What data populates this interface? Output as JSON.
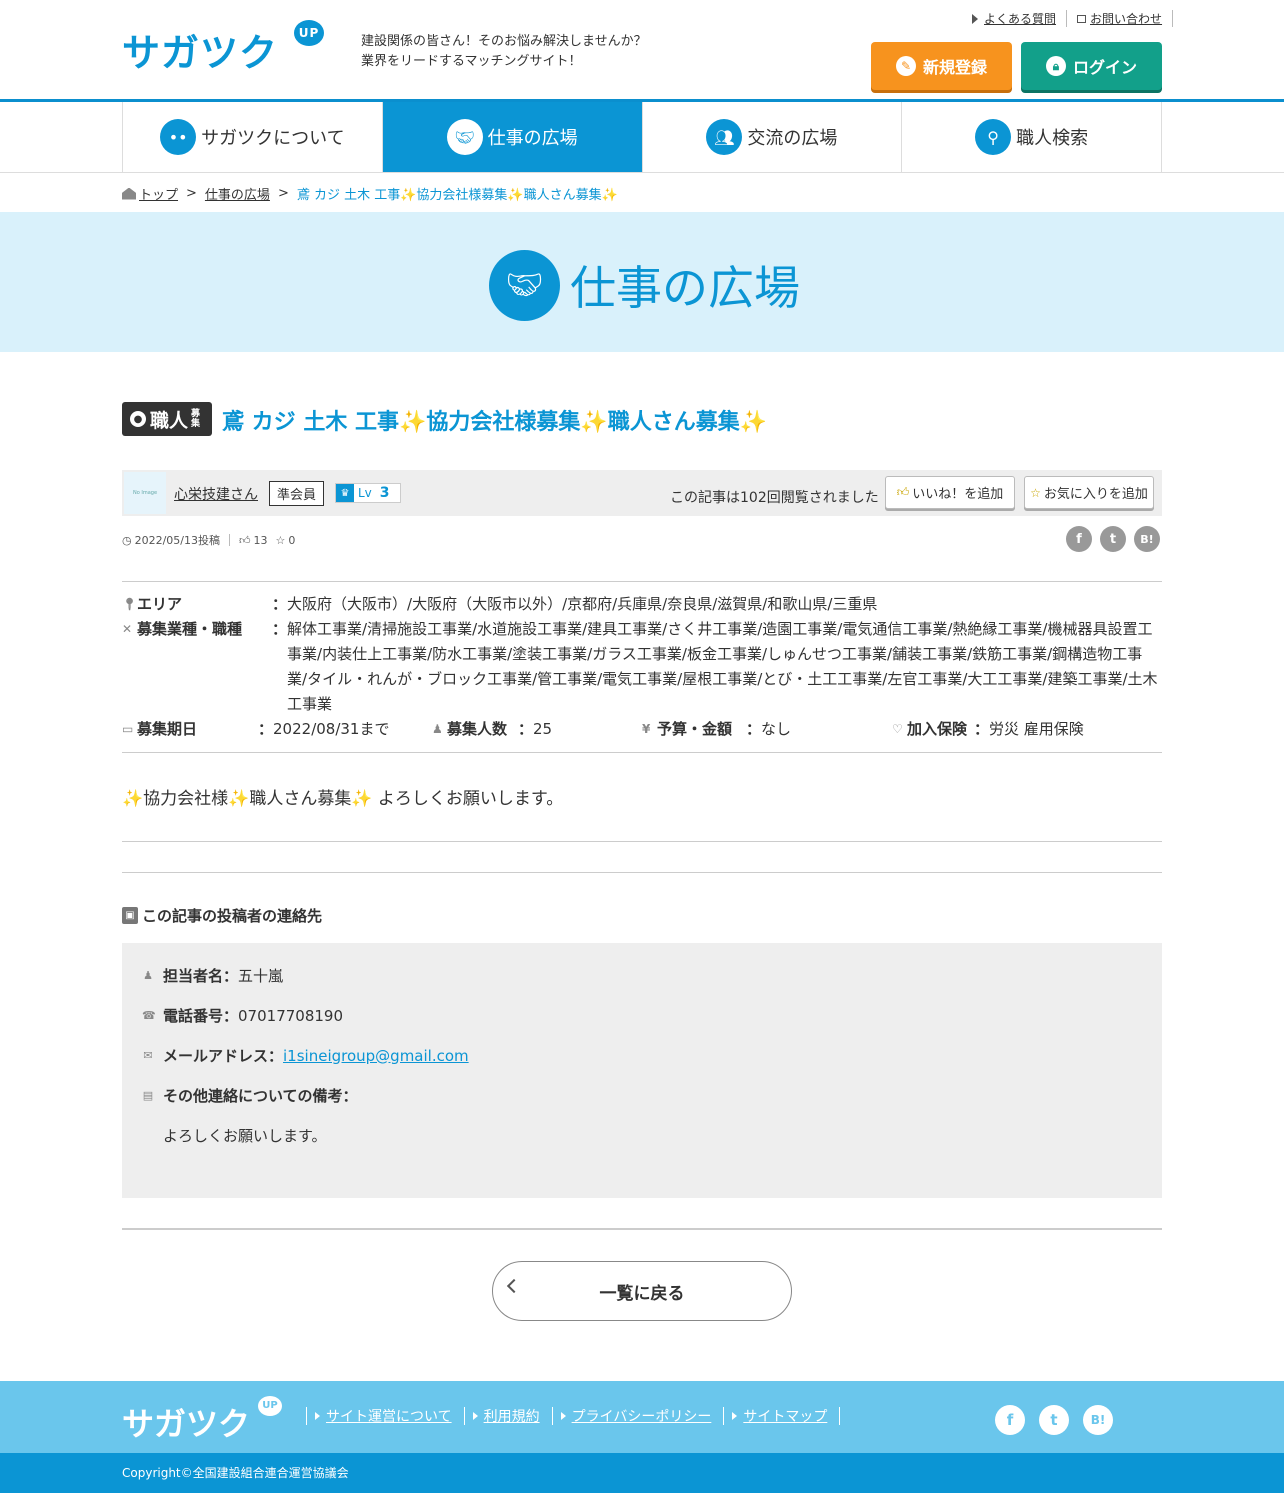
{
  "header": {
    "logo": "サガツク",
    "logo_badge": "UP",
    "tagline_1": "建設関係の皆さん！そのお悩み解決しませんか？",
    "tagline_2": "業界をリードするマッチングサイト！",
    "faq": "よくある質問",
    "contact": "お問い合わせ",
    "register": "新規登録",
    "login": "ログイン"
  },
  "nav": {
    "items": [
      {
        "label": "サガツクについて"
      },
      {
        "label": "仕事の広場"
      },
      {
        "label": "交流の広場"
      },
      {
        "label": "職人検索"
      }
    ]
  },
  "breadcrumb": {
    "top": "トップ",
    "section": "仕事の広場",
    "current": "鳶 カジ 土木 工事✨協力会社様募集✨職人さん募集✨"
  },
  "banner": {
    "title": "仕事の広場"
  },
  "post": {
    "badge": "職人",
    "badge_small": "募集",
    "title": "鳶 カジ 土木 工事✨協力会社様募集✨職人さん募集✨",
    "author_image": "No Image",
    "author": "心栄技建さん",
    "member_type": "準会員",
    "level_prefix": "Lv",
    "level": "3",
    "views": "この記事は102回閲覧されました",
    "like_button": "いいね！を追加",
    "fav_button": "お気に入りを追加",
    "date": "2022/05/13投稿",
    "likes": "13",
    "favorites": "0",
    "social": [
      "f",
      "t",
      "B!"
    ]
  },
  "details": {
    "area_label": "エリア",
    "area": "大阪府（大阪市）/大阪府（大阪市以外）/京都府/兵庫県/奈良県/滋賀県/和歌山県/三重県",
    "trade_label": "募集業種・職種",
    "trade": "解体工事業/清掃施設工事業/水道施設工事業/建具工事業/さく井工事業/造園工事業/電気通信工事業/熱絶縁工事業/機械器具設置工事業/内装仕上工事業/防水工事業/塗装工事業/ガラス工事業/板金工事業/しゅんせつ工事業/舗装工事業/鉄筋工事業/鋼構造物工事業/タイル・れんが・ブロック工事業/管工事業/電気工事業/屋根工事業/とび・土工工事業/左官工事業/大工工事業/建築工事業/土木工事業",
    "period_label": "募集期日",
    "period": "2022/08/31まで",
    "count_label": "募集人数",
    "count": "25",
    "budget_label": "予算・金額",
    "budget": "なし",
    "insurance_label": "加入保険",
    "insurance": "労災 雇用保険",
    "colon": "："
  },
  "body": "✨協力会社様✨職人さん募集✨ よろしくお願いします。",
  "contact": {
    "heading": "この記事の投稿者の連絡先",
    "person_label": "担当者名：",
    "person": "五十嵐",
    "phone_label": "電話番号：",
    "phone": "07017708190",
    "email_label": "メールアドレス：",
    "email": "i1sineigroup@gmail.com",
    "note_label": "その他連絡についての備考：",
    "note": "よろしくお願いします。"
  },
  "back_button": "一覧に戻る",
  "footer": {
    "logo": "サガツク",
    "logo_badge": "UP",
    "links": [
      "サイト運営について",
      "利用規約",
      "プライバシーポリシー",
      "サイトマップ"
    ],
    "social": [
      "f",
      "t",
      "B!"
    ],
    "copyright": "Copyright©全国建設組合連合運営協議会"
  },
  "colors": {
    "primary": "#0b95d4",
    "register": "#f7931e",
    "login": "#12a08a",
    "footer": "#6ac6ec"
  }
}
